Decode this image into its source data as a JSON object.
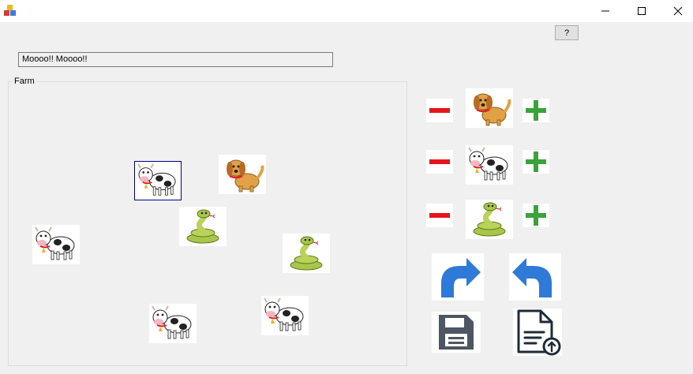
{
  "window": {
    "app_icon": "blocks-icon",
    "controls": [
      "minimize-icon",
      "maximize-icon",
      "close-icon"
    ]
  },
  "help_button": {
    "label": "?"
  },
  "message": {
    "value": "Moooo!! Moooo!!"
  },
  "farm": {
    "label": "Farm",
    "animals": [
      {
        "kind": "cow",
        "selected": true
      },
      {
        "kind": "dog",
        "selected": false
      },
      {
        "kind": "snake",
        "selected": false
      },
      {
        "kind": "cow",
        "selected": false
      },
      {
        "kind": "snake",
        "selected": false
      },
      {
        "kind": "cow",
        "selected": false
      },
      {
        "kind": "cow",
        "selected": false
      }
    ]
  },
  "controls": {
    "rows": [
      {
        "animal": "dog",
        "remove_icon": "minus-icon",
        "add_icon": "plus-icon"
      },
      {
        "animal": "cow",
        "remove_icon": "minus-icon",
        "add_icon": "plus-icon"
      },
      {
        "animal": "snake",
        "remove_icon": "minus-icon",
        "add_icon": "plus-icon"
      }
    ],
    "redo_icon": "redo-icon",
    "undo_icon": "undo-icon",
    "save_icon": "save-icon",
    "load_icon": "file-upload-icon"
  },
  "colors": {
    "minus": "#e8141c",
    "plus": "#3aa33a",
    "arrow": "#2f7ad8",
    "selection_border": "#00008b"
  }
}
